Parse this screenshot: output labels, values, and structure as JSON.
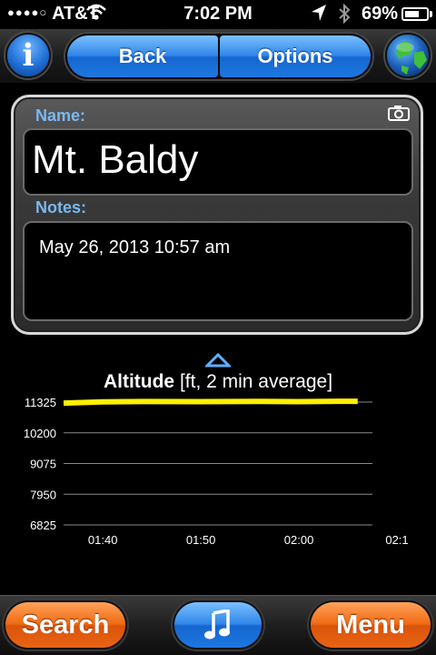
{
  "status_bar": {
    "carrier": "AT&T",
    "time": "7:02 PM",
    "battery_percent": "69%",
    "battery_level": 0.69
  },
  "nav": {
    "back_label": "Back",
    "options_label": "Options",
    "info_label": "i"
  },
  "waypoint": {
    "name_label": "Name:",
    "name_value": "Mt. Baldy",
    "notes_label": "Notes:",
    "notes_value": "May 26, 2013 10:57 am"
  },
  "chart_data": {
    "type": "line",
    "title": "Altitude",
    "subtitle": "[ft, 2 min average]",
    "yticks": [
      "11325",
      "10200",
      "9075",
      "7950",
      "6825"
    ],
    "ytick_values": [
      11325,
      10200,
      9075,
      7950,
      6825
    ],
    "ylim": [
      6825,
      11325
    ],
    "xticks": [
      "01:40",
      "01:50",
      "02:00",
      "02:1"
    ],
    "xtick_minutes": [
      100,
      110,
      120,
      130
    ],
    "xlim": [
      96,
      130
    ],
    "grid": true,
    "series": [
      {
        "color": "#ffef00",
        "x": [
          96,
          100,
          104,
          110,
          116,
          120,
          124,
          126
        ],
        "y": [
          11290,
          11330,
          11345,
          11340,
          11350,
          11340,
          11355,
          11355
        ]
      }
    ]
  },
  "toolbar": {
    "search_label": "Search",
    "menu_label": "Menu"
  },
  "colors": {
    "accent_blue": "#2f86e8",
    "accent_orange": "#f06a12",
    "label_blue": "#7ab8f0",
    "series_yellow": "#ffef00"
  },
  "icons": [
    "wifi-icon",
    "location-arrow-icon",
    "bluetooth-icon",
    "battery-icon",
    "info-icon",
    "globe-icon",
    "camera-icon",
    "chart-toggle-arrow-icon",
    "music-note-icon"
  ]
}
